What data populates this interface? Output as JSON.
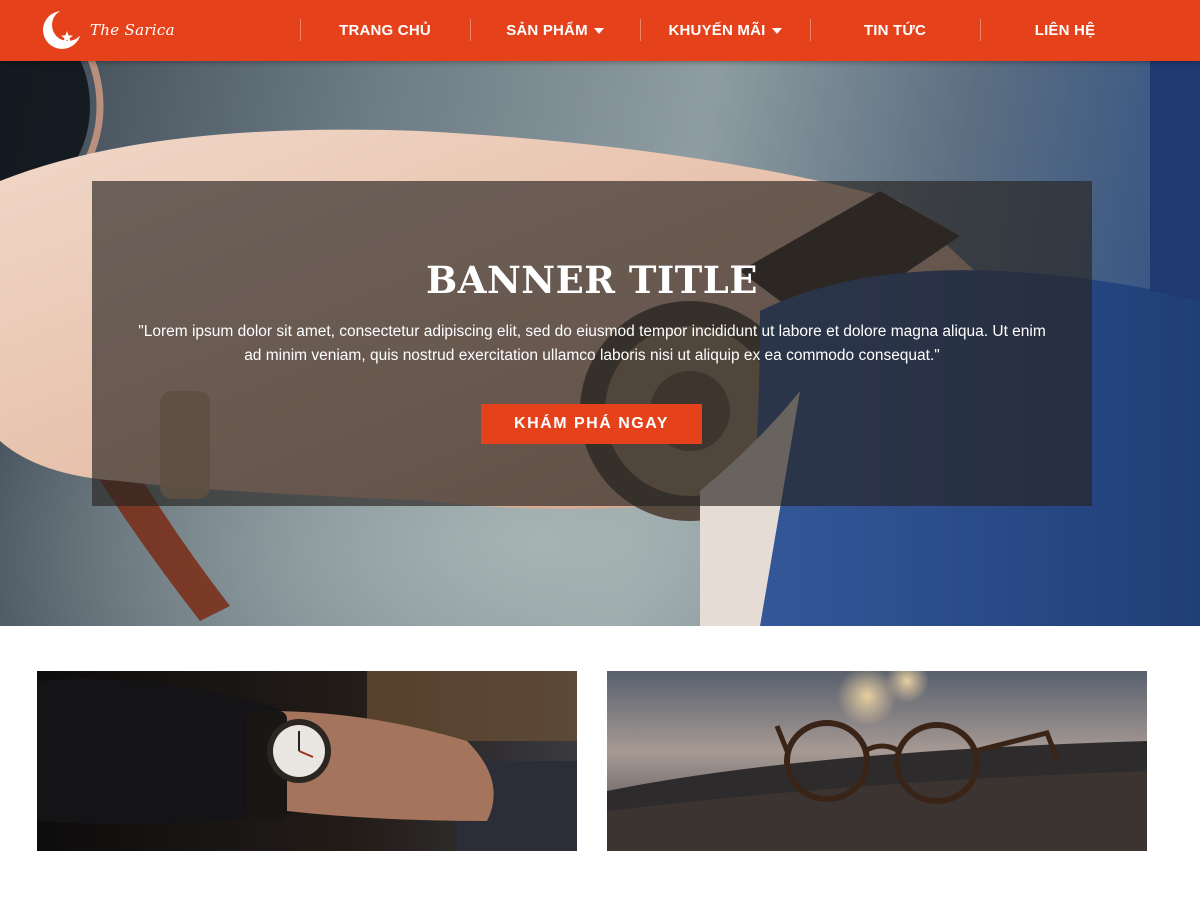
{
  "brand": {
    "name": "The Sarica",
    "logo_icon": "crescent-star-logo-icon",
    "color": "#e5411a"
  },
  "nav": {
    "items": [
      {
        "label": "TRANG CHỦ",
        "has_dropdown": false
      },
      {
        "label": "SẢN PHẨM",
        "has_dropdown": true
      },
      {
        "label": "KHUYẾN MÃI",
        "has_dropdown": true
      },
      {
        "label": "TIN TỨC",
        "has_dropdown": false
      },
      {
        "label": "LIÊN HỆ",
        "has_dropdown": false
      }
    ]
  },
  "hero": {
    "image": "hand-with-wristwatch-and-sunglasses-photo",
    "title": "BANNER TITLE",
    "text": "\"Lorem ipsum dolor sit amet, consectetur adipiscing elit, sed do eiusmod tempor incididunt ut labore et dolore magna aliqua. Ut enim ad minim veniam, quis nostrud exercitation ullamco laboris nisi ut aliquip ex ea commodo consequat.\"",
    "cta_label": "KHÁM PHÁ NGAY",
    "overlay_color": "#282422"
  },
  "tiles": [
    {
      "image": "wristwatch-on-arm-photo"
    },
    {
      "image": "eyeglasses-on-rock-photo"
    }
  ]
}
